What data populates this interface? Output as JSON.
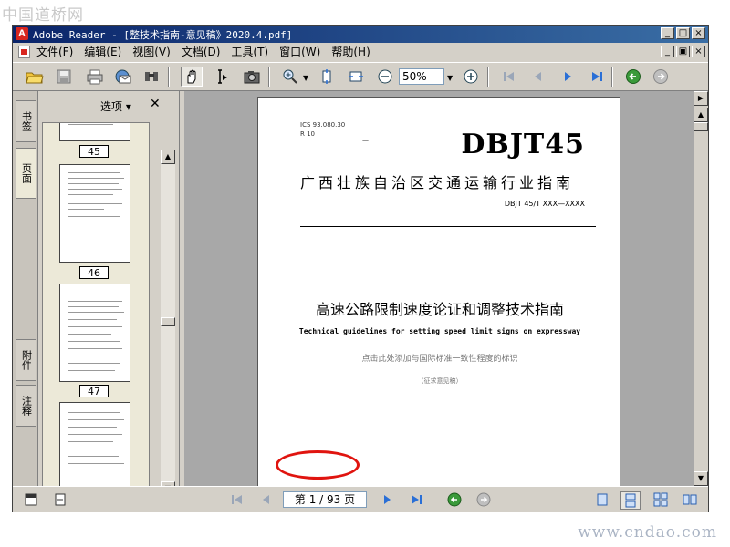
{
  "watermark": {
    "top": "中国道桥网",
    "bottom": "www.cndao.com"
  },
  "window": {
    "title": "Adobe Reader - [整技术指南-意见稿》2020.4.pdf]",
    "controls": {
      "minimize": "_",
      "maximize": "□",
      "close": "×"
    },
    "mdi_controls": {
      "minimize": "_",
      "restore": "▣",
      "close": "×"
    }
  },
  "menu": {
    "items": [
      "文件(F)",
      "编辑(E)",
      "视图(V)",
      "文档(D)",
      "工具(T)",
      "窗口(W)",
      "帮助(H)"
    ]
  },
  "toolbar": {
    "zoom_value": "50%",
    "icons": [
      "open-icon",
      "save-icon",
      "print-icon",
      "email-icon",
      "search-icon",
      "hand-icon",
      "select-text-icon",
      "snapshot-icon",
      "zoom-in-tool-icon",
      "fit-page-icon",
      "fit-width-icon",
      "zoom-out-icon",
      "zoom-in-icon",
      "first-page-icon",
      "prev-page-icon",
      "next-page-icon",
      "last-page-icon",
      "go-back-icon",
      "go-forward-icon"
    ]
  },
  "nav_panel": {
    "tabs": [
      "书签",
      "页面",
      "附件",
      "注释"
    ],
    "options_label": "选项 ▾",
    "close_label": "✕",
    "thumbnails": [
      {
        "label": "45"
      },
      {
        "label": "46"
      },
      {
        "label": "47"
      },
      {
        "label": ""
      }
    ]
  },
  "document": {
    "ics": "ICS  93.080.30",
    "r10": "R 10",
    "standard_code": "DBJT45",
    "organization": "广西壮族自治区交通运输行业指南",
    "number": "DBJT 45/T XXX—XXXX",
    "title_cn": "高速公路限制速度论证和调整技术指南",
    "title_en": "Technical guidelines for setting speed limit signs on expressway",
    "placeholder_note": "点击此处添加与国际标准一致性程度的标识",
    "draft_note": "（征求意见稿）"
  },
  "statusbar": {
    "page_indicator": "第 1 / 93 页"
  },
  "colors": {
    "titlebar": "#0a246a",
    "chrome": "#d4d0c8",
    "annotation_ellipse": "#e0140f"
  }
}
